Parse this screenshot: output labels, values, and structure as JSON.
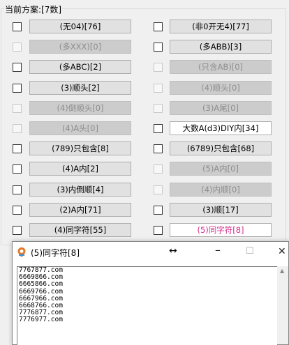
{
  "group": {
    "title": "当前方案:[7数]"
  },
  "left": [
    {
      "label": "(无04)[76]",
      "disabled": false
    },
    {
      "label": "(多XXX)[0]",
      "disabled": true
    },
    {
      "label": "(多ABC)[2]",
      "disabled": false
    },
    {
      "label": "(3)顺头[2]",
      "disabled": false
    },
    {
      "label": "(4)倒顺头[0]",
      "disabled": true
    },
    {
      "label": "(4)A头[0]",
      "disabled": true
    },
    {
      "label": "(789)只包含[8]",
      "disabled": false
    },
    {
      "label": "(4)A内[2]",
      "disabled": false
    },
    {
      "label": "(3)内倒顺[4]",
      "disabled": false
    },
    {
      "label": "(2)A内[71]",
      "disabled": false
    },
    {
      "label": "(4)同字符[55]",
      "disabled": false
    }
  ],
  "right": [
    {
      "label": "(非0开无4)[77]",
      "disabled": false
    },
    {
      "label": "(多ABB)[3]",
      "disabled": false
    },
    {
      "label": "(只含AB)[0]",
      "disabled": true
    },
    {
      "label": "(4)顺头[0]",
      "disabled": true
    },
    {
      "label": "(3)A尾[0]",
      "disabled": true
    },
    {
      "label": "大数A(d3)DIY内[34]",
      "disabled": false,
      "style": "white"
    },
    {
      "label": "(6789)只包含[68]",
      "disabled": false
    },
    {
      "label": "(5)A内[0]",
      "disabled": true
    },
    {
      "label": "(4)内顺[0]",
      "disabled": true
    },
    {
      "label": "(3)顺[17]",
      "disabled": false
    },
    {
      "label": "(5)同字符[8]",
      "disabled": false,
      "style": "pink"
    }
  ],
  "popup": {
    "title": "(5)同字符[8]",
    "lines": [
      "7767877.com",
      "6669866.com",
      "6665866.com",
      "6669766.com",
      "6667966.com",
      "6668766.com",
      "7776877.com",
      "7776977.com"
    ]
  },
  "colors": {
    "pink": "#d42a8b",
    "disabled_text": "#8d8d8d"
  }
}
